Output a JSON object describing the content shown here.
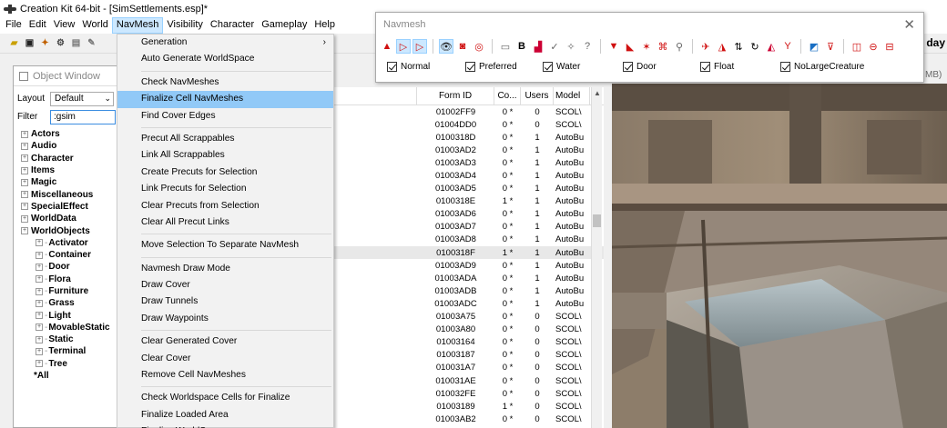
{
  "window": {
    "title": "Creation Kit 64-bit - [SimSettlements.esp]*"
  },
  "menubar": {
    "items": [
      {
        "label": "File",
        "active": false
      },
      {
        "label": "Edit",
        "active": false
      },
      {
        "label": "View",
        "active": false
      },
      {
        "label": "World",
        "active": false
      },
      {
        "label": "NavMesh",
        "active": true
      },
      {
        "label": "Visibility",
        "active": false
      },
      {
        "label": "Character",
        "active": false
      },
      {
        "label": "Gameplay",
        "active": false
      },
      {
        "label": "Help",
        "active": false
      }
    ]
  },
  "toolbar": {
    "overflow_text": "f day"
  },
  "object_window": {
    "title": "Object Window",
    "layout_label": "Layout",
    "layout_value": "Default",
    "filter_label": "Filter",
    "filter_value": ":gsim",
    "tree": [
      {
        "label": "Actors",
        "level": 0
      },
      {
        "label": "Audio",
        "level": 0
      },
      {
        "label": "Character",
        "level": 0
      },
      {
        "label": "Items",
        "level": 0
      },
      {
        "label": "Magic",
        "level": 0
      },
      {
        "label": "Miscellaneous",
        "level": 0
      },
      {
        "label": "SpecialEffect",
        "level": 0
      },
      {
        "label": "WorldData",
        "level": 0
      },
      {
        "label": "WorldObjects",
        "level": 0
      },
      {
        "label": "Activator",
        "level": 1
      },
      {
        "label": "Container",
        "level": 1
      },
      {
        "label": "Door",
        "level": 1
      },
      {
        "label": "Flora",
        "level": 1
      },
      {
        "label": "Furniture",
        "level": 1
      },
      {
        "label": "Grass",
        "level": 1
      },
      {
        "label": "Light",
        "level": 1
      },
      {
        "label": "MovableStatic",
        "level": 1
      },
      {
        "label": "Static",
        "level": 1
      },
      {
        "label": "Terminal",
        "level": 1
      },
      {
        "label": "Tree",
        "level": 1
      },
      {
        "label": "*All",
        "level": 0
      }
    ]
  },
  "navmesh_menu": {
    "groups": [
      [
        {
          "label": "Generation",
          "submenu": true
        },
        {
          "label": "Auto Generate WorldSpace"
        }
      ],
      [
        {
          "label": "Check NavMeshes"
        },
        {
          "label": "Finalize Cell NavMeshes",
          "highlighted": true
        },
        {
          "label": "Find Cover Edges"
        }
      ],
      [
        {
          "label": "Precut All Scrappables"
        },
        {
          "label": "Link All Scrappables"
        },
        {
          "label": "Create Precuts for Selection"
        },
        {
          "label": "Link Precuts for Selection"
        },
        {
          "label": "Clear Precuts from Selection"
        },
        {
          "label": "Clear All Precut Links"
        }
      ],
      [
        {
          "label": "Move Selection To Separate NavMesh"
        }
      ],
      [
        {
          "label": "Navmesh Draw Mode"
        },
        {
          "label": "Draw Cover"
        },
        {
          "label": "Draw Tunnels"
        },
        {
          "label": "Draw Waypoints"
        }
      ],
      [
        {
          "label": "Clear Generated Cover"
        },
        {
          "label": "Clear Cover"
        },
        {
          "label": "Remove Cell NavMeshes"
        }
      ],
      [
        {
          "label": "Check Worldspace Cells for Finalize"
        },
        {
          "label": "Finalize Loaded Area"
        },
        {
          "label": "Finalize WorldSpace"
        }
      ]
    ]
  },
  "cell_table": {
    "headers": {
      "form_id": "Form ID",
      "count": "Co...",
      "users": "Users",
      "model": "Model"
    },
    "rows": [
      {
        "form_id": "01002FF9",
        "count": "0 *",
        "users": "0",
        "model": "SCOL\\"
      },
      {
        "form_id": "01004DD0",
        "count": "0 *",
        "users": "0",
        "model": "SCOL\\"
      },
      {
        "form_id": "0100318D",
        "count": "0 *",
        "users": "1",
        "model": "AutoBu"
      },
      {
        "form_id": "01003AD2",
        "count": "0 *",
        "users": "1",
        "model": "AutoBu"
      },
      {
        "form_id": "01003AD3",
        "count": "0 *",
        "users": "1",
        "model": "AutoBu"
      },
      {
        "form_id": "01003AD4",
        "count": "0 *",
        "users": "1",
        "model": "AutoBu"
      },
      {
        "form_id": "01003AD5",
        "count": "0 *",
        "users": "1",
        "model": "AutoBu"
      },
      {
        "form_id": "0100318E",
        "count": "1 *",
        "users": "1",
        "model": "AutoBu"
      },
      {
        "form_id": "01003AD6",
        "count": "0 *",
        "users": "1",
        "model": "AutoBu"
      },
      {
        "form_id": "01003AD7",
        "count": "0 *",
        "users": "1",
        "model": "AutoBu"
      },
      {
        "form_id": "01003AD8",
        "count": "0 *",
        "users": "1",
        "model": "AutoBu"
      },
      {
        "form_id": "0100318F",
        "count": "1 *",
        "users": "1",
        "model": "AutoBu",
        "highlight": true
      },
      {
        "form_id": "01003AD9",
        "count": "0 *",
        "users": "1",
        "model": "AutoBu"
      },
      {
        "form_id": "01003ADA",
        "count": "0 *",
        "users": "1",
        "model": "AutoBu"
      },
      {
        "form_id": "01003ADB",
        "count": "0 *",
        "users": "1",
        "model": "AutoBu"
      },
      {
        "form_id": "01003ADC",
        "count": "0 *",
        "users": "1",
        "model": "AutoBu"
      },
      {
        "form_id": "01003A75",
        "count": "0 *",
        "users": "0",
        "model": "SCOL\\"
      },
      {
        "form_id": "01003A80",
        "count": "0 *",
        "users": "0",
        "model": "SCOL\\"
      },
      {
        "form_id": "01003164",
        "count": "0 *",
        "users": "0",
        "model": "SCOL\\"
      },
      {
        "form_id": "01003187",
        "count": "0 *",
        "users": "0",
        "model": "SCOL\\"
      },
      {
        "form_id": "010031A7",
        "count": "0 *",
        "users": "0",
        "model": "SCOL\\"
      },
      {
        "form_id": "010031AE",
        "count": "0 *",
        "users": "0",
        "model": "SCOL\\"
      },
      {
        "form_id": "010032FE",
        "count": "0 *",
        "users": "0",
        "model": "SCOL\\"
      },
      {
        "form_id": "01003189",
        "count": "1 *",
        "users": "0",
        "model": "SCOL\\"
      },
      {
        "form_id": "01003AB2",
        "count": "0 *",
        "users": "0",
        "model": "SCOL\\"
      }
    ]
  },
  "navmesh_window": {
    "title": "Navmesh",
    "close_glyph": "✕",
    "checkboxes": [
      {
        "label": "Normal",
        "checked": true
      },
      {
        "label": "Preferred",
        "checked": true
      },
      {
        "label": "Water",
        "checked": true
      },
      {
        "label": "Door",
        "checked": true
      },
      {
        "label": "Float",
        "checked": true
      },
      {
        "label": "NoLargeCreature",
        "checked": true
      }
    ]
  },
  "memory_suffix": "MB)"
}
